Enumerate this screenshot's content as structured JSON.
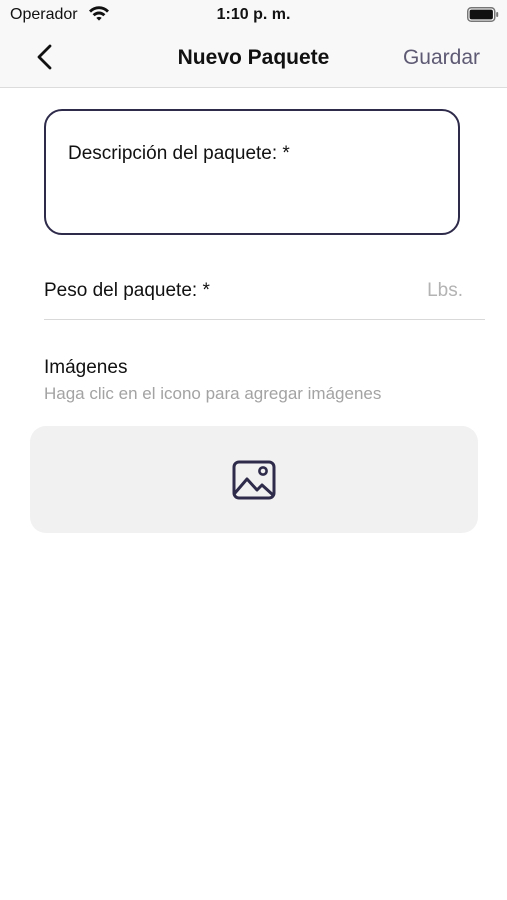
{
  "status_bar": {
    "carrier": "Operador",
    "time": "1:10 p. m.",
    "icons": [
      "wifi-icon",
      "battery-icon"
    ]
  },
  "nav": {
    "back_icon": "chevron-left-icon",
    "title": "Nuevo Paquete",
    "save_label": "Guardar",
    "save_color": "#5e5a74"
  },
  "form": {
    "description_label": "Descripción del paquete: *",
    "weight_label": "Peso del paquete: *",
    "weight_unit_placeholder": "Lbs.",
    "images_title": "Imágenes",
    "images_hint": "Haga clic en el icono para agregar imágenes",
    "image_icon": "image-add-icon"
  },
  "colors": {
    "accent_dark": "#2e2a4a",
    "placeholder": "#b3b3b3",
    "picker_background": "#f1f1f1"
  }
}
